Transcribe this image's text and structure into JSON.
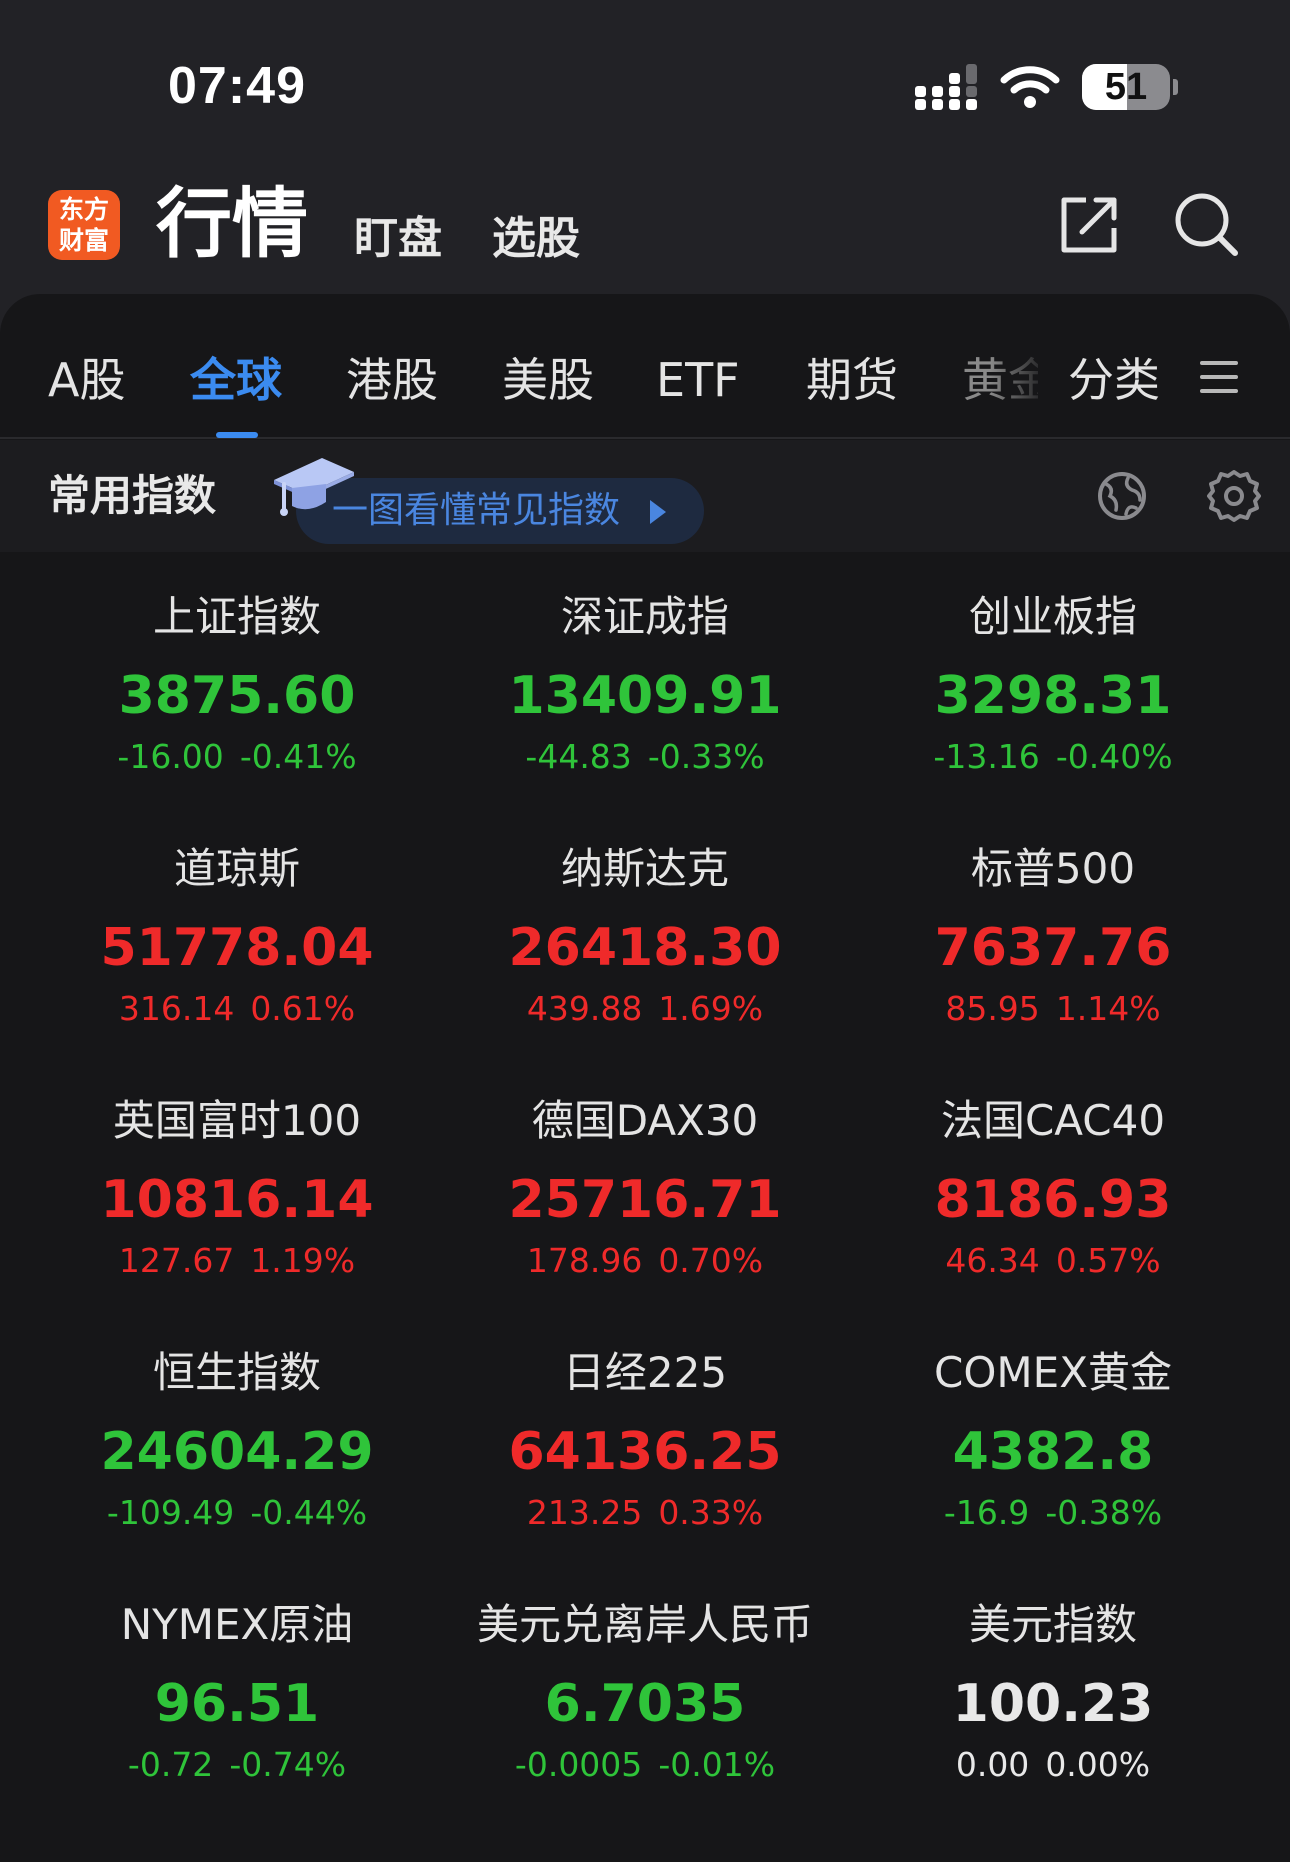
{
  "status": {
    "time": "07:49",
    "battery": "51",
    "battery_level": 0.51
  },
  "app": {
    "logo_text": "东方\n财富",
    "title": "行情",
    "header_tabs": [
      "盯盘",
      "选股"
    ]
  },
  "market_tabs": {
    "items": [
      "A股",
      "全球",
      "港股",
      "美股",
      "ETF",
      "期货",
      "黄金",
      "分类"
    ],
    "active_index": 1,
    "accent_color": "#3b8bf0"
  },
  "section": {
    "title": "常用指数",
    "guide_label": "一图看懂常见指数"
  },
  "colors": {
    "up": "#ef2a2a",
    "down": "#2fc43a",
    "flat": "#e8e8e8"
  },
  "indices": [
    {
      "name": "上证指数",
      "price": "3875.60",
      "change": "-16.00",
      "percent": "-0.41%",
      "trend": "down"
    },
    {
      "name": "深证成指",
      "price": "13409.91",
      "change": "-44.83",
      "percent": "-0.33%",
      "trend": "down"
    },
    {
      "name": "创业板指",
      "price": "3298.31",
      "change": "-13.16",
      "percent": "-0.40%",
      "trend": "down"
    },
    {
      "name": "道琼斯",
      "price": "51778.04",
      "change": "316.14",
      "percent": "0.61%",
      "trend": "up"
    },
    {
      "name": "纳斯达克",
      "price": "26418.30",
      "change": "439.88",
      "percent": "1.69%",
      "trend": "up"
    },
    {
      "name": "标普500",
      "price": "7637.76",
      "change": "85.95",
      "percent": "1.14%",
      "trend": "up"
    },
    {
      "name": "英国富时100",
      "price": "10816.14",
      "change": "127.67",
      "percent": "1.19%",
      "trend": "up"
    },
    {
      "name": "德国DAX30",
      "price": "25716.71",
      "change": "178.96",
      "percent": "0.70%",
      "trend": "up"
    },
    {
      "name": "法国CAC40",
      "price": "8186.93",
      "change": "46.34",
      "percent": "0.57%",
      "trend": "up"
    },
    {
      "name": "恒生指数",
      "price": "24604.29",
      "change": "-109.49",
      "percent": "-0.44%",
      "trend": "down"
    },
    {
      "name": "日经225",
      "price": "64136.25",
      "change": "213.25",
      "percent": "0.33%",
      "trend": "up"
    },
    {
      "name": "COMEX黄金",
      "price": "4382.8",
      "change": "-16.9",
      "percent": "-0.38%",
      "trend": "down"
    },
    {
      "name": "NYMEX原油",
      "price": "96.51",
      "change": "-0.72",
      "percent": "-0.74%",
      "trend": "down"
    },
    {
      "name": "美元兑离岸人民币",
      "price": "6.7035",
      "change": "-0.0005",
      "percent": "-0.01%",
      "trend": "down"
    },
    {
      "name": "美元指数",
      "price": "100.23",
      "change": "0.00",
      "percent": "0.00%",
      "trend": "flat"
    }
  ]
}
